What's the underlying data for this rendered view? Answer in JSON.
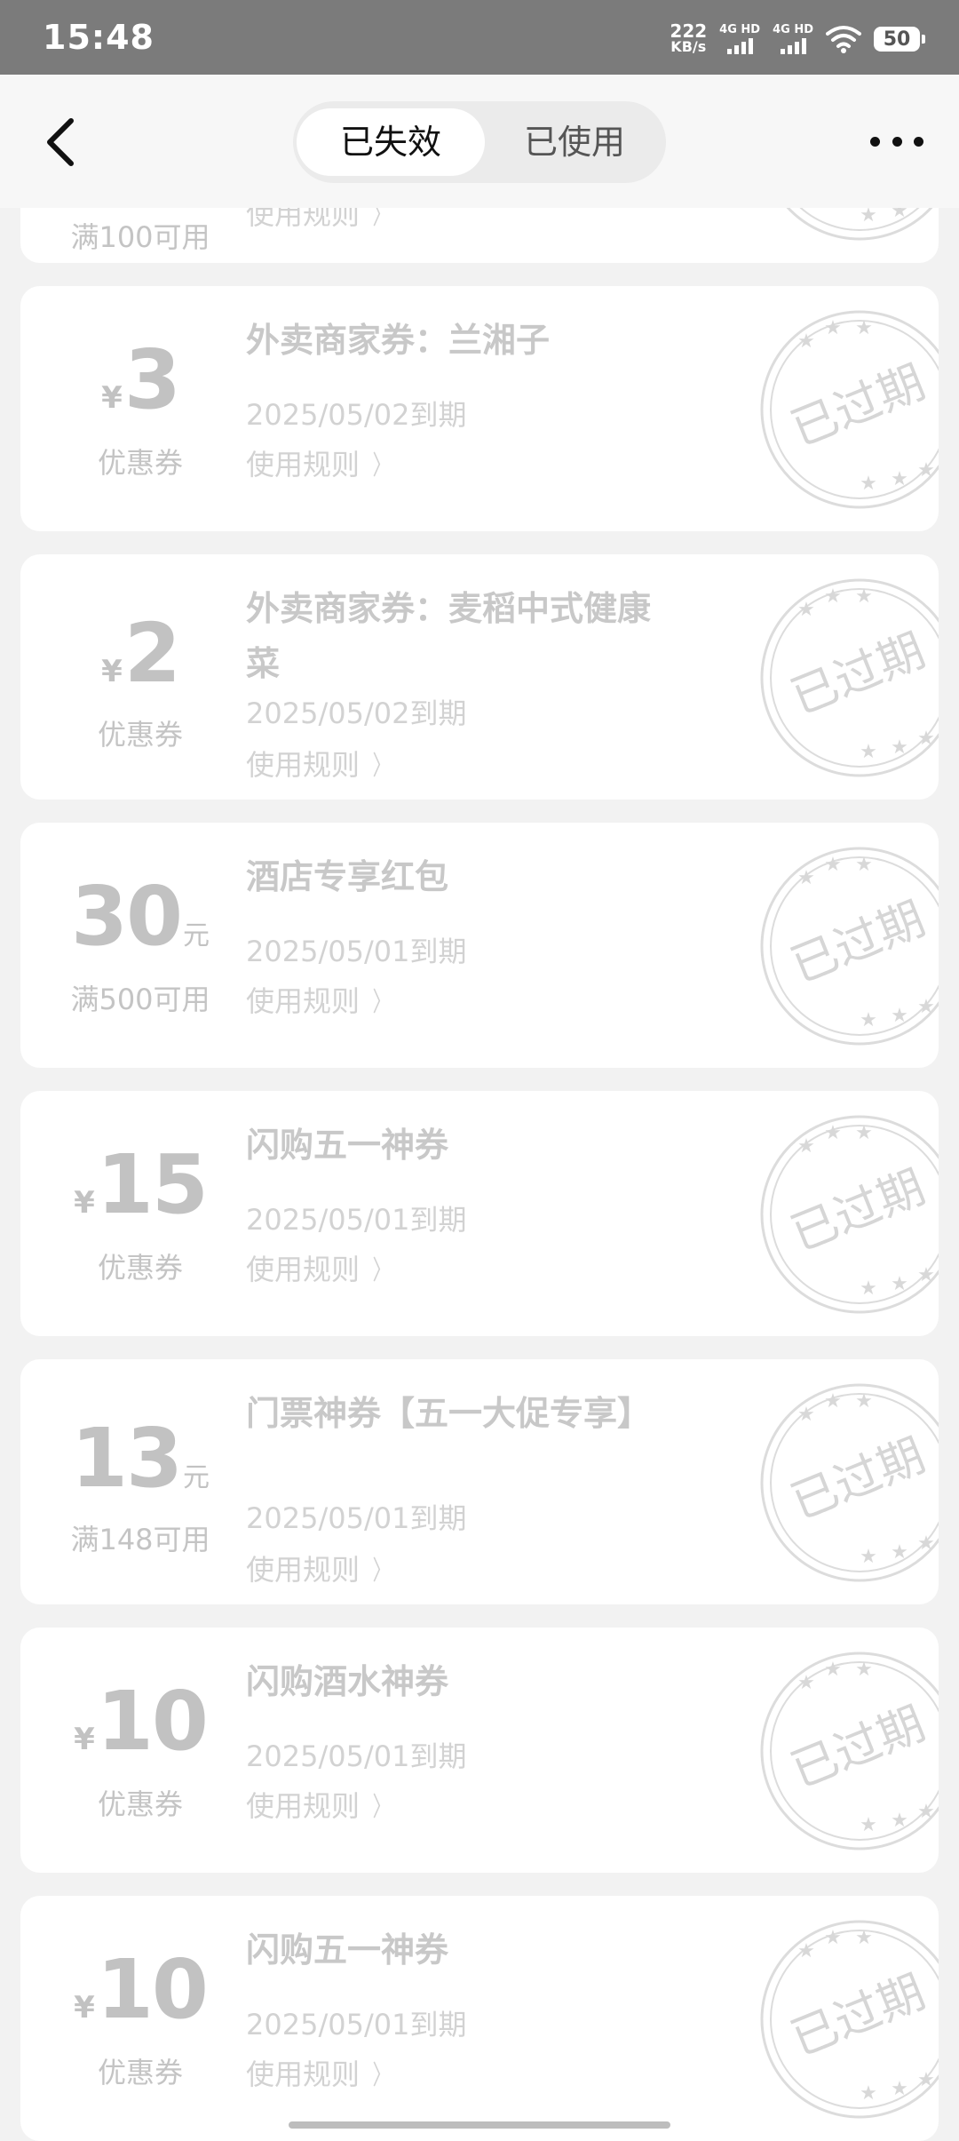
{
  "status_bar": {
    "time": "15:48",
    "net_speed": "222",
    "net_unit": "KB/s",
    "sim1_label": "4G HD",
    "sim2_label": "4G HD",
    "battery": "50"
  },
  "header": {
    "tabs": [
      {
        "label": "已失效",
        "active": true
      },
      {
        "label": "已使用",
        "active": false
      }
    ]
  },
  "stamp_text": "已过期",
  "rules_label": "使用规则",
  "coupons": [
    {
      "currency": "",
      "amount": "",
      "unit": "",
      "subtitle": "满100可用",
      "title": "",
      "date": "",
      "partial": true
    },
    {
      "currency": "¥",
      "amount": "3",
      "unit": "",
      "subtitle": "优惠券",
      "title": "外卖商家券：兰湘子",
      "date": "2025/05/02到期"
    },
    {
      "currency": "¥",
      "amount": "2",
      "unit": "",
      "subtitle": "优惠券",
      "title": "外卖商家券：麦稻中式健康菜",
      "date": "2025/05/02到期"
    },
    {
      "currency": "",
      "amount": "30",
      "unit": "元",
      "subtitle": "满500可用",
      "title": "酒店专享红包",
      "date": "2025/05/01到期"
    },
    {
      "currency": "¥",
      "amount": "15",
      "unit": "",
      "subtitle": "优惠券",
      "title": "闪购五一神券",
      "date": "2025/05/01到期"
    },
    {
      "currency": "",
      "amount": "13",
      "unit": "元",
      "subtitle": "满148可用",
      "title": "门票神券【五一大促专享】",
      "date": "2025/05/01到期"
    },
    {
      "currency": "¥",
      "amount": "10",
      "unit": "",
      "subtitle": "优惠券",
      "title": "闪购酒水神券",
      "date": "2025/05/01到期"
    },
    {
      "currency": "¥",
      "amount": "10",
      "unit": "",
      "subtitle": "优惠券",
      "title": "闪购五一神券",
      "date": "2025/05/01到期"
    }
  ]
}
